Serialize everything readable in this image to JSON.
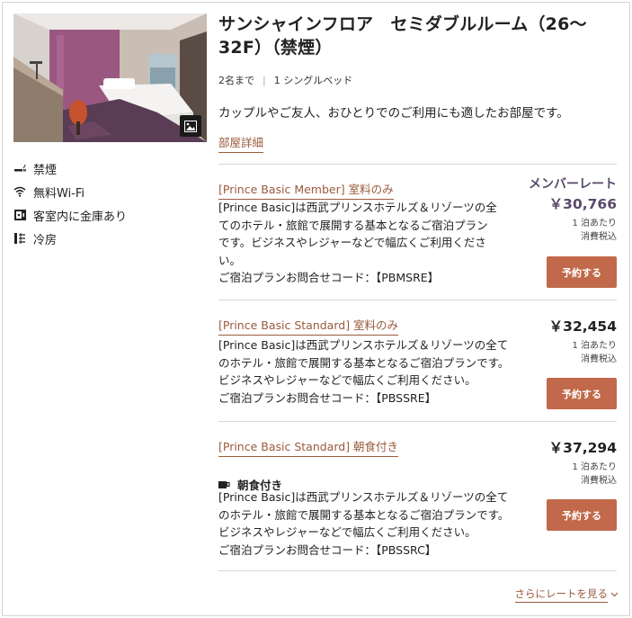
{
  "room": {
    "title_line1": "サンシャインフロア　セミダブルルーム（26〜",
    "title_line2": "32F）（禁煙）",
    "capacity": "2名まで",
    "bed": "1 シングルベッド",
    "description": "カップルやご友人、おひとりでのご利用にも適したお部屋です。",
    "detail_link": "部屋詳細"
  },
  "amenities": [
    {
      "icon": "no-smoking-icon",
      "label": "禁煙"
    },
    {
      "icon": "wifi-icon",
      "label": "無料Wi-Fi"
    },
    {
      "icon": "safe-icon",
      "label": "客室内に金庫あり"
    },
    {
      "icon": "air-conditioning-icon",
      "label": "冷房"
    }
  ],
  "plans": [
    {
      "name": "[Prince Basic Member] 室料のみ",
      "body_lines": [
        "[Prince Basic]は西武プリンスホテルズ＆リゾーツの全",
        "てのホテル・旅館で展開する基本となるご宿泊プラン",
        "です。ビジネスやレジャーなどで幅広くご利用くださ",
        "い。"
      ],
      "code": "ご宿泊プランお問合せコード：【PBMSRE】",
      "member_label": "メンバーレート",
      "price": "￥30,766",
      "per_night": "1 泊あたり",
      "tax": "消費税込",
      "button": "予約する"
    },
    {
      "name": "[Prince Basic Standard] 室料のみ",
      "body_lines": [
        "[Prince Basic]は西武プリンスホテルズ＆リゾーツの全て",
        "のホテル・旅館で展開する基本となるご宿泊プランです。",
        "ビジネスやレジャーなどで幅広くご利用ください。"
      ],
      "code": "ご宿泊プランお問合せコード：【PBSSRE】",
      "price": "￥32,454",
      "per_night": "1 泊あたり",
      "tax": "消費税込",
      "button": "予約する"
    },
    {
      "name": "[Prince Basic Standard] 朝食付き",
      "breakfast": "朝食付き",
      "body_lines": [
        "[Prince Basic]は西武プリンスホテルズ＆リゾーツの全て",
        "のホテル・旅館で展開する基本となるご宿泊プランです。",
        "ビジネスやレジャーなどで幅広くご利用ください。"
      ],
      "code": "ご宿泊プランお問合せコード：【PBSSRC】",
      "price": "￥37,294",
      "per_night": "1 泊あたり",
      "tax": "消費税込",
      "button": "予約する"
    }
  ],
  "more_rates": "さらにレートを見る",
  "colors": {
    "accent": "#9a5a3c",
    "button": "#c1694a",
    "member": "#5a4a6a"
  }
}
